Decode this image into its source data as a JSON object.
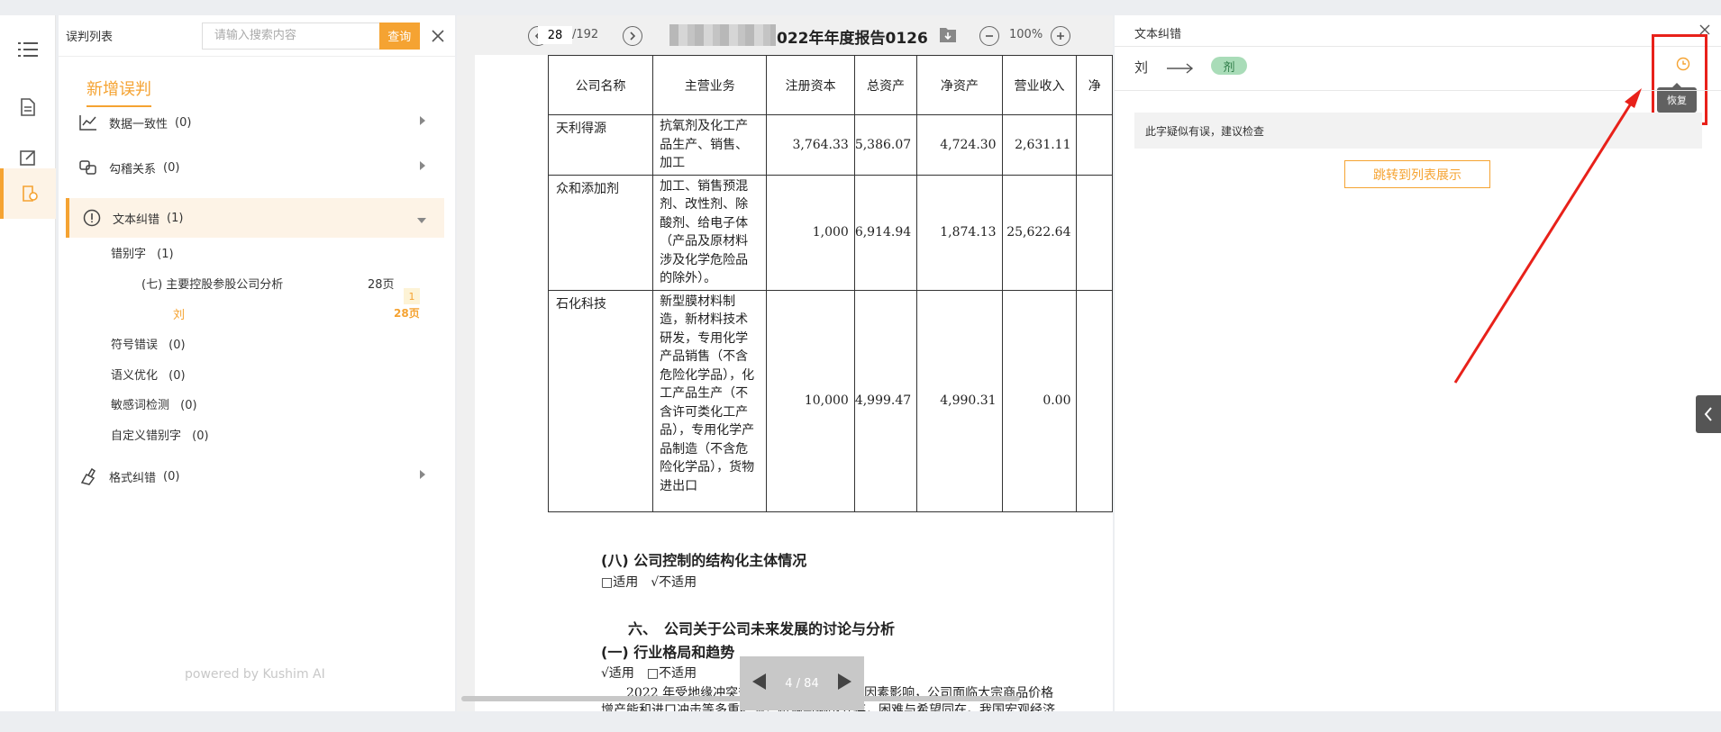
{
  "left_panel": {
    "title": "误判列表",
    "search_placeholder": "请输入搜索内容",
    "search_button": "查询",
    "new_tab": "新增误判",
    "categories": [
      {
        "label": "数据一致性",
        "count": "(0)"
      },
      {
        "label": "勾稽关系",
        "count": "(0)"
      },
      {
        "label": "文本纠错",
        "count": "(1)"
      },
      {
        "label": "格式纠错",
        "count": "(0)"
      }
    ],
    "subcategories": [
      {
        "label": "错别字",
        "count": "(1)"
      },
      {
        "label": "符号错误",
        "count": "(0)"
      },
      {
        "label": "语义优化",
        "count": "(0)"
      },
      {
        "label": "敏感词检测",
        "count": "(0)"
      },
      {
        "label": "自定义错别字",
        "count": "(0)"
      }
    ],
    "section_item": {
      "label": "(七) 主要控股参股公司分析",
      "page": "28页",
      "badge": "1"
    },
    "error_item": {
      "word": "刘",
      "page": "28页"
    },
    "powered_by": "powered by Kushim AI"
  },
  "viewer": {
    "page_current": "28",
    "page_total": "/192",
    "doc_title": "022年年度报告0126",
    "zoom": "100%",
    "table": {
      "headers": [
        "公司名称",
        "主营业务",
        "注册资本",
        "总资产",
        "净资产",
        "营业收入",
        "净"
      ],
      "rows": [
        {
          "name": "天利得源",
          "biz": "抗氧剂及化工产品生产、销售、加工",
          "capital": "3,764.33",
          "assets": "5,386.07",
          "net": "4,724.30",
          "revenue": "2,631.11"
        },
        {
          "name": "众和添加剂",
          "biz": "加工、销售预混剂、改性剂、除酸剂、给电子体（产品及原材料涉及化学危险品的除外）。",
          "capital": "1,000",
          "assets": "6,914.94",
          "net": "1,874.13",
          "revenue": "25,622.64"
        },
        {
          "name": "石化科技",
          "biz": "新型膜材料制造，新材料技术研发，专用化学产品销售（不含危险化学品），化工产品生产（不含许可类化工产品），专用化学产品制造（不含危险化学品），货物进出口",
          "capital": "10,000",
          "assets": "4,999.47",
          "net": "4,990.31",
          "revenue": "0.00"
        }
      ]
    },
    "section8_title": "(八) 公司控制的结构化主体情况",
    "section8_options": "□适用　√不适用",
    "section6_title": "六、　公司关于公司未来发展的讨论与分析",
    "section6_1": "(一) 行业格局和趋势",
    "section6_options": "√适用　□不适用",
    "para1": "2022 年受地缘冲突升级、通胀上行等不利因素影响，公司面临大宗商品价格",
    "para2": "增产能和进口冲击等多重考验，机遇与挑战并存，困难与希望同在。我国宏观经济",
    "pager": "4 / 84"
  },
  "right_panel": {
    "title": "文本纠错",
    "original_word": "刘",
    "suggested_word": "剂",
    "tooltip": "恢复",
    "message": "此字疑似有误，建议检查",
    "jump_button": "跳转到列表展示"
  },
  "colors": {
    "accent": "#f5a332",
    "highlight_red": "#e8211a",
    "suggest_green": "#a9dcb8"
  }
}
